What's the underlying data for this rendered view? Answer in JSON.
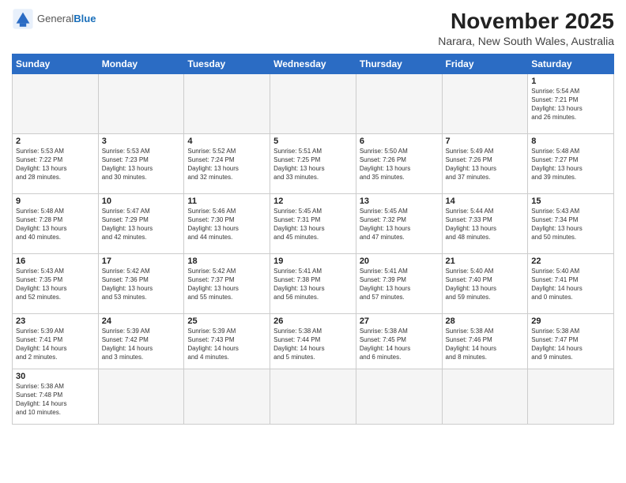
{
  "header": {
    "logo_general": "General",
    "logo_blue": "Blue",
    "title": "November 2025",
    "subtitle": "Narara, New South Wales, Australia"
  },
  "weekdays": [
    "Sunday",
    "Monday",
    "Tuesday",
    "Wednesday",
    "Thursday",
    "Friday",
    "Saturday"
  ],
  "days": [
    {
      "num": "",
      "info": ""
    },
    {
      "num": "",
      "info": ""
    },
    {
      "num": "",
      "info": ""
    },
    {
      "num": "",
      "info": ""
    },
    {
      "num": "",
      "info": ""
    },
    {
      "num": "",
      "info": ""
    },
    {
      "num": "1",
      "info": "Sunrise: 5:54 AM\nSunset: 7:21 PM\nDaylight: 13 hours\nand 26 minutes."
    },
    {
      "num": "2",
      "info": "Sunrise: 5:53 AM\nSunset: 7:22 PM\nDaylight: 13 hours\nand 28 minutes."
    },
    {
      "num": "3",
      "info": "Sunrise: 5:53 AM\nSunset: 7:23 PM\nDaylight: 13 hours\nand 30 minutes."
    },
    {
      "num": "4",
      "info": "Sunrise: 5:52 AM\nSunset: 7:24 PM\nDaylight: 13 hours\nand 32 minutes."
    },
    {
      "num": "5",
      "info": "Sunrise: 5:51 AM\nSunset: 7:25 PM\nDaylight: 13 hours\nand 33 minutes."
    },
    {
      "num": "6",
      "info": "Sunrise: 5:50 AM\nSunset: 7:26 PM\nDaylight: 13 hours\nand 35 minutes."
    },
    {
      "num": "7",
      "info": "Sunrise: 5:49 AM\nSunset: 7:26 PM\nDaylight: 13 hours\nand 37 minutes."
    },
    {
      "num": "8",
      "info": "Sunrise: 5:48 AM\nSunset: 7:27 PM\nDaylight: 13 hours\nand 39 minutes."
    },
    {
      "num": "9",
      "info": "Sunrise: 5:48 AM\nSunset: 7:28 PM\nDaylight: 13 hours\nand 40 minutes."
    },
    {
      "num": "10",
      "info": "Sunrise: 5:47 AM\nSunset: 7:29 PM\nDaylight: 13 hours\nand 42 minutes."
    },
    {
      "num": "11",
      "info": "Sunrise: 5:46 AM\nSunset: 7:30 PM\nDaylight: 13 hours\nand 44 minutes."
    },
    {
      "num": "12",
      "info": "Sunrise: 5:45 AM\nSunset: 7:31 PM\nDaylight: 13 hours\nand 45 minutes."
    },
    {
      "num": "13",
      "info": "Sunrise: 5:45 AM\nSunset: 7:32 PM\nDaylight: 13 hours\nand 47 minutes."
    },
    {
      "num": "14",
      "info": "Sunrise: 5:44 AM\nSunset: 7:33 PM\nDaylight: 13 hours\nand 48 minutes."
    },
    {
      "num": "15",
      "info": "Sunrise: 5:43 AM\nSunset: 7:34 PM\nDaylight: 13 hours\nand 50 minutes."
    },
    {
      "num": "16",
      "info": "Sunrise: 5:43 AM\nSunset: 7:35 PM\nDaylight: 13 hours\nand 52 minutes."
    },
    {
      "num": "17",
      "info": "Sunrise: 5:42 AM\nSunset: 7:36 PM\nDaylight: 13 hours\nand 53 minutes."
    },
    {
      "num": "18",
      "info": "Sunrise: 5:42 AM\nSunset: 7:37 PM\nDaylight: 13 hours\nand 55 minutes."
    },
    {
      "num": "19",
      "info": "Sunrise: 5:41 AM\nSunset: 7:38 PM\nDaylight: 13 hours\nand 56 minutes."
    },
    {
      "num": "20",
      "info": "Sunrise: 5:41 AM\nSunset: 7:39 PM\nDaylight: 13 hours\nand 57 minutes."
    },
    {
      "num": "21",
      "info": "Sunrise: 5:40 AM\nSunset: 7:40 PM\nDaylight: 13 hours\nand 59 minutes."
    },
    {
      "num": "22",
      "info": "Sunrise: 5:40 AM\nSunset: 7:41 PM\nDaylight: 14 hours\nand 0 minutes."
    },
    {
      "num": "23",
      "info": "Sunrise: 5:39 AM\nSunset: 7:41 PM\nDaylight: 14 hours\nand 2 minutes."
    },
    {
      "num": "24",
      "info": "Sunrise: 5:39 AM\nSunset: 7:42 PM\nDaylight: 14 hours\nand 3 minutes."
    },
    {
      "num": "25",
      "info": "Sunrise: 5:39 AM\nSunset: 7:43 PM\nDaylight: 14 hours\nand 4 minutes."
    },
    {
      "num": "26",
      "info": "Sunrise: 5:38 AM\nSunset: 7:44 PM\nDaylight: 14 hours\nand 5 minutes."
    },
    {
      "num": "27",
      "info": "Sunrise: 5:38 AM\nSunset: 7:45 PM\nDaylight: 14 hours\nand 6 minutes."
    },
    {
      "num": "28",
      "info": "Sunrise: 5:38 AM\nSunset: 7:46 PM\nDaylight: 14 hours\nand 8 minutes."
    },
    {
      "num": "29",
      "info": "Sunrise: 5:38 AM\nSunset: 7:47 PM\nDaylight: 14 hours\nand 9 minutes."
    },
    {
      "num": "30",
      "info": "Sunrise: 5:38 AM\nSunset: 7:48 PM\nDaylight: 14 hours\nand 10 minutes."
    },
    {
      "num": "",
      "info": ""
    },
    {
      "num": "",
      "info": ""
    },
    {
      "num": "",
      "info": ""
    },
    {
      "num": "",
      "info": ""
    },
    {
      "num": "",
      "info": ""
    },
    {
      "num": "",
      "info": ""
    }
  ]
}
